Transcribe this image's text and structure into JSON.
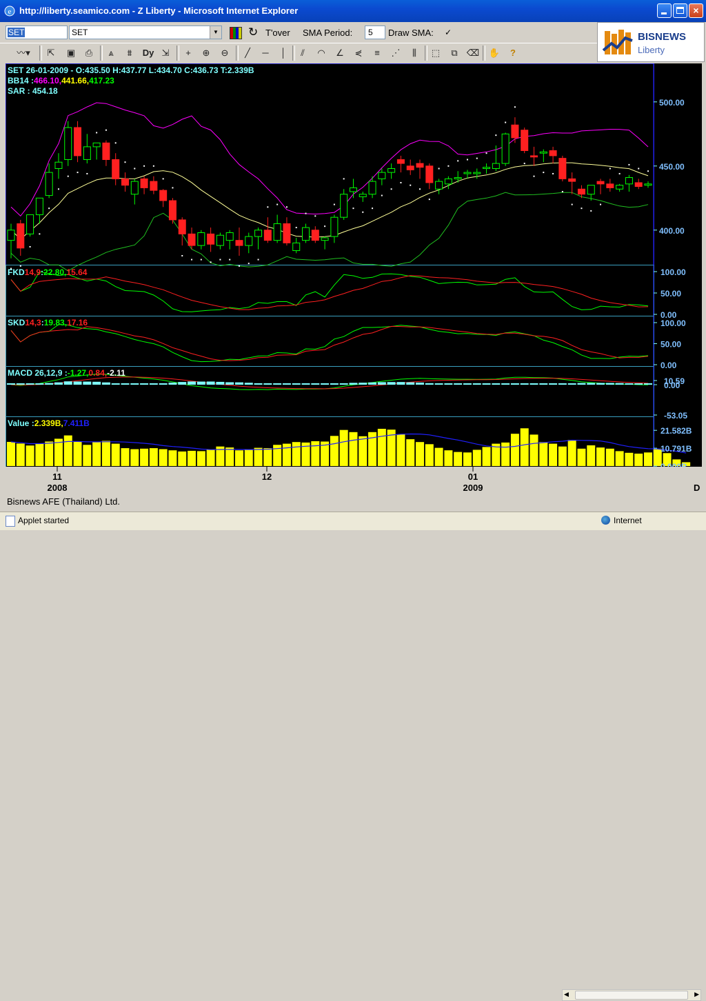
{
  "window": {
    "title": "http://liberty.seamico.com - Z Liberty - Microsoft Internet Explorer"
  },
  "toolbar": {
    "symbol_value": "SET",
    "symbol_select": "SET",
    "tover_label": "T'over",
    "sma_period_label": "SMA Period:",
    "sma_period_value": "5",
    "draw_sma_label": "Draw SMA:",
    "draw_sma_check": "✓"
  },
  "logo": {
    "brand": "BISNEWS",
    "sub": "Liberty"
  },
  "colors": {
    "green": "#00ff00",
    "red": "#ff2020",
    "magenta": "#ff00ff",
    "yellow": "#ffff00",
    "cyan": "#7fffff",
    "blue": "#2020ff",
    "axis": "#00ffff"
  },
  "panels": {
    "price": {
      "info1": "SET 26-01-2009 - O:435.50 H:437.77 L:434.70 C:436.73 T:2.339B",
      "bb_label": "BB14 :",
      "bb_upper": "466.10,",
      "bb_mid": "441.66,",
      "bb_lower": "417.23",
      "sar_label": "SAR : 454.18",
      "ticks": [
        "500.00",
        "450.00",
        "400.00"
      ]
    },
    "fkd": {
      "name": "FKD",
      "params": "14,9",
      "sep": " :",
      "k": "22.80,",
      "d": "15.64",
      "ticks": [
        "100.00",
        "50.00",
        "0.00"
      ]
    },
    "skd": {
      "name": "SKD",
      "params": "14,3",
      "sep": " :",
      "k": "19.83,",
      "d": "17.16",
      "ticks": [
        "100.00",
        "50.00",
        "0.00"
      ]
    },
    "macd": {
      "name": "MACD 26,12,9 :",
      "v1": "-1.27,",
      "v2": "0.84,",
      "v3": "-2.11",
      "ticks": [
        "10.59",
        "0.00",
        "-53.05"
      ]
    },
    "value": {
      "name": "Value :",
      "v1": "2.339B,",
      "v2": "7.411B",
      "ticks": [
        "21.582B",
        "10.791B",
        "0.000B"
      ]
    }
  },
  "xaxis": {
    "labels": [
      {
        "text": "11",
        "sub": "2008"
      },
      {
        "text": "12",
        "sub": ""
      },
      {
        "text": "01",
        "sub": "2009"
      }
    ],
    "corner": "D"
  },
  "chart_data": {
    "type": "candlestick",
    "ohlc": [
      [
        392,
        405,
        378,
        400
      ],
      [
        405,
        408,
        380,
        386
      ],
      [
        397,
        412,
        395,
        412
      ],
      [
        412,
        425,
        405,
        425
      ],
      [
        427,
        452,
        425,
        445
      ],
      [
        448,
        460,
        440,
        453
      ],
      [
        455,
        485,
        450,
        480
      ],
      [
        480,
        485,
        453,
        458
      ],
      [
        455,
        475,
        452,
        465
      ],
      [
        465,
        468,
        455,
        468
      ],
      [
        468,
        470,
        450,
        455
      ],
      [
        455,
        460,
        435,
        440
      ],
      [
        440,
        445,
        430,
        435
      ],
      [
        428,
        440,
        420,
        438
      ],
      [
        440,
        442,
        428,
        433
      ],
      [
        438,
        442,
        428,
        431
      ],
      [
        431,
        432,
        418,
        423
      ],
      [
        423,
        425,
        405,
        408
      ],
      [
        408,
        410,
        388,
        397
      ],
      [
        397,
        402,
        385,
        388
      ],
      [
        388,
        400,
        385,
        398
      ],
      [
        397,
        402,
        383,
        389
      ],
      [
        388,
        398,
        385,
        396
      ],
      [
        392,
        400,
        385,
        398
      ],
      [
        392,
        402,
        380,
        388
      ],
      [
        388,
        398,
        382,
        395
      ],
      [
        395,
        402,
        385,
        400
      ],
      [
        400,
        410,
        390,
        392
      ],
      [
        392,
        412,
        390,
        405
      ],
      [
        405,
        410,
        388,
        390
      ],
      [
        384,
        394,
        382,
        390
      ],
      [
        392,
        405,
        390,
        402
      ],
      [
        400,
        403,
        390,
        392
      ],
      [
        392,
        395,
        385,
        394
      ],
      [
        395,
        412,
        390,
        410
      ],
      [
        410,
        432,
        408,
        428
      ],
      [
        430,
        440,
        425,
        433
      ],
      [
        426,
        430,
        422,
        428
      ],
      [
        428,
        442,
        425,
        438
      ],
      [
        440,
        448,
        435,
        445
      ],
      [
        445,
        452,
        440,
        448
      ],
      [
        455,
        458,
        445,
        452
      ],
      [
        450,
        455,
        443,
        447
      ],
      [
        452,
        455,
        440,
        449
      ],
      [
        450,
        452,
        432,
        437
      ],
      [
        432,
        440,
        428,
        438
      ],
      [
        436,
        442,
        432,
        440
      ],
      [
        440,
        446,
        437,
        441
      ],
      [
        444,
        447,
        440,
        445
      ],
      [
        444,
        448,
        440,
        445
      ],
      [
        448,
        452,
        444,
        449
      ],
      [
        448,
        466,
        446,
        452
      ],
      [
        452,
        476,
        450,
        475
      ],
      [
        482,
        488,
        468,
        472
      ],
      [
        478,
        480,
        460,
        462
      ],
      [
        458,
        465,
        450,
        457
      ],
      [
        460,
        463,
        453,
        461
      ],
      [
        462,
        465,
        452,
        458
      ],
      [
        456,
        458,
        438,
        440
      ],
      [
        440,
        445,
        428,
        438
      ],
      [
        432,
        435,
        425,
        428
      ],
      [
        428,
        435,
        423,
        435
      ],
      [
        438,
        440,
        428,
        436
      ],
      [
        436,
        440,
        430,
        433
      ],
      [
        432,
        436,
        430,
        435
      ],
      [
        436,
        443,
        430,
        441
      ],
      [
        437,
        440,
        432,
        434
      ],
      [
        435,
        438,
        433,
        436
      ]
    ],
    "volume": [
      14.6,
      13.6,
      12.4,
      13.5,
      14.8,
      16.5,
      18.5,
      14.8,
      12.8,
      14.5,
      15.2,
      13.5,
      10.8,
      10.2,
      10.5,
      10.8,
      10.2,
      9.5,
      8.8,
      9.2,
      9.0,
      10.0,
      11.8,
      11.2,
      9.5,
      10.2,
      11.0,
      10.8,
      12.8,
      13.5,
      14.5,
      14.2,
      15.0,
      14.8,
      18.2,
      21.8,
      20.5,
      18.0,
      20.5,
      22.5,
      22.0,
      19.2,
      16.2,
      14.5,
      13.2,
      11.0,
      9.5,
      8.5,
      8.2,
      9.8,
      11.5,
      13.5,
      14.2,
      19.5,
      22.8,
      19.0,
      14.5,
      13.5,
      11.8,
      15.8,
      10.5,
      12.5,
      11.2,
      10.5,
      9.0,
      8.0,
      7.5,
      8.2,
      10.5,
      7.8,
      4.0,
      2.3
    ],
    "price_range": [
      373,
      530
    ],
    "volume_range": [
      0,
      25
    ]
  }
}
